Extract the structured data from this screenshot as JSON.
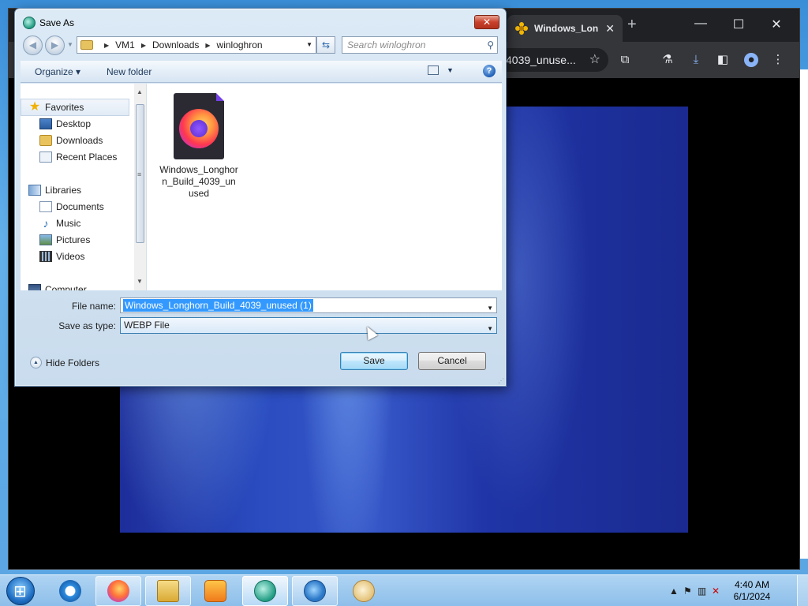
{
  "browser": {
    "tab_title": "Windows_Lon",
    "tab_close": "✕",
    "new_tab": "+",
    "minimize": "—",
    "maximize": "☐",
    "close": "✕",
    "omnibox_text": "4039_unuse...",
    "star": "☆",
    "toolbar_icons": [
      "extensions-icon",
      "labs-icon",
      "download-icon",
      "side-panel-icon",
      "profile-icon",
      "menu-icon"
    ]
  },
  "dialog": {
    "title": "Save As",
    "close_label": "✕",
    "breadcrumb": [
      "VM1",
      "Downloads",
      "winloghron"
    ],
    "search_placeholder": "Search winloghron",
    "organize_label": "Organize ▾",
    "new_folder_label": "New folder",
    "help_label": "?",
    "nav": {
      "favorites": "Favorites",
      "desktop": "Desktop",
      "downloads": "Downloads",
      "recent_places": "Recent Places",
      "libraries": "Libraries",
      "documents": "Documents",
      "music": "Music",
      "pictures": "Pictures",
      "videos": "Videos",
      "computer": "Computer"
    },
    "files": [
      {
        "name": "Windows_Longhorn_Build_4039_unused",
        "icon": "firefox-document-icon"
      }
    ],
    "file_name_label": "File name:",
    "file_name_value": "Windows_Longhorn_Build_4039_unused (1)",
    "save_type_label": "Save as type:",
    "save_type_value": "WEBP File",
    "hide_folders_label": "Hide Folders",
    "save_button": "Save",
    "cancel_button": "Cancel"
  },
  "taskbar": {
    "apps": [
      "internet-explorer-icon",
      "firefox-icon",
      "windows-explorer-icon",
      "media-player-icon",
      "app-icon",
      "download-manager-icon",
      "paint-icon"
    ],
    "time": "4:40 AM",
    "date": "6/1/2024"
  }
}
